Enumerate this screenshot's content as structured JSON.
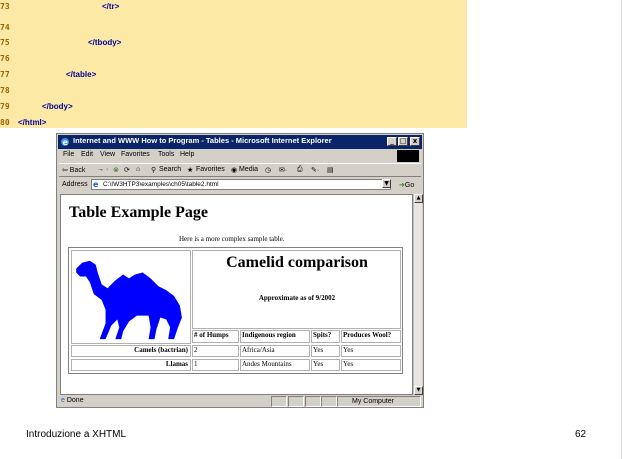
{
  "code_listing": {
    "lines": [
      {
        "num": "73",
        "code": "</tr>"
      },
      {
        "num": "74",
        "code": ""
      },
      {
        "num": "75",
        "code": "</tbody>"
      },
      {
        "num": "76",
        "code": ""
      },
      {
        "num": "77",
        "code": "</table>"
      },
      {
        "num": "78",
        "code": ""
      },
      {
        "num": "79",
        "code": "</body>"
      },
      {
        "num": "80",
        "code": "</html>"
      }
    ]
  },
  "browser": {
    "title": "Internet and WWW How to Program - Tables - Microsoft Internet Explorer",
    "menu": [
      "File",
      "Edit",
      "View",
      "Favorites",
      "Tools",
      "Help"
    ],
    "toolbar": {
      "back": "⇦ Back",
      "search": "Search",
      "favorites": "Favorites",
      "media": "Media"
    },
    "address_label": "Address",
    "address_value": "C:\\IW3HTP3\\examples\\ch05\\table2.html",
    "go_label": "Go",
    "status_text": "Done",
    "zone_text": "My Computer"
  },
  "page": {
    "title": "Table Example Page",
    "caption": "Here is a more complex sample table.",
    "table": {
      "heading": "Camelid comparison",
      "subheading": "Approximate as of 9/2002",
      "columns": [
        "# of Humps",
        "Indigenous region",
        "Spits?",
        "Produces Wool?"
      ],
      "rows": [
        {
          "name": "Camels (bactrian)",
          "cells": [
            "2",
            "Africa/Asia",
            "Yes",
            "Yes"
          ]
        },
        {
          "name": "Llamas",
          "cells": [
            "1",
            "Andes Mountains",
            "Yes",
            "Yes"
          ]
        }
      ]
    }
  },
  "footer": {
    "left": "Introduzione a XHTML",
    "page_number": "62"
  },
  "colors": {
    "code_bg": "#fde9a6",
    "code_tag": "#000099",
    "line_number": "#996600",
    "titlebar": "#0a246a",
    "camel": "#0000ff"
  }
}
